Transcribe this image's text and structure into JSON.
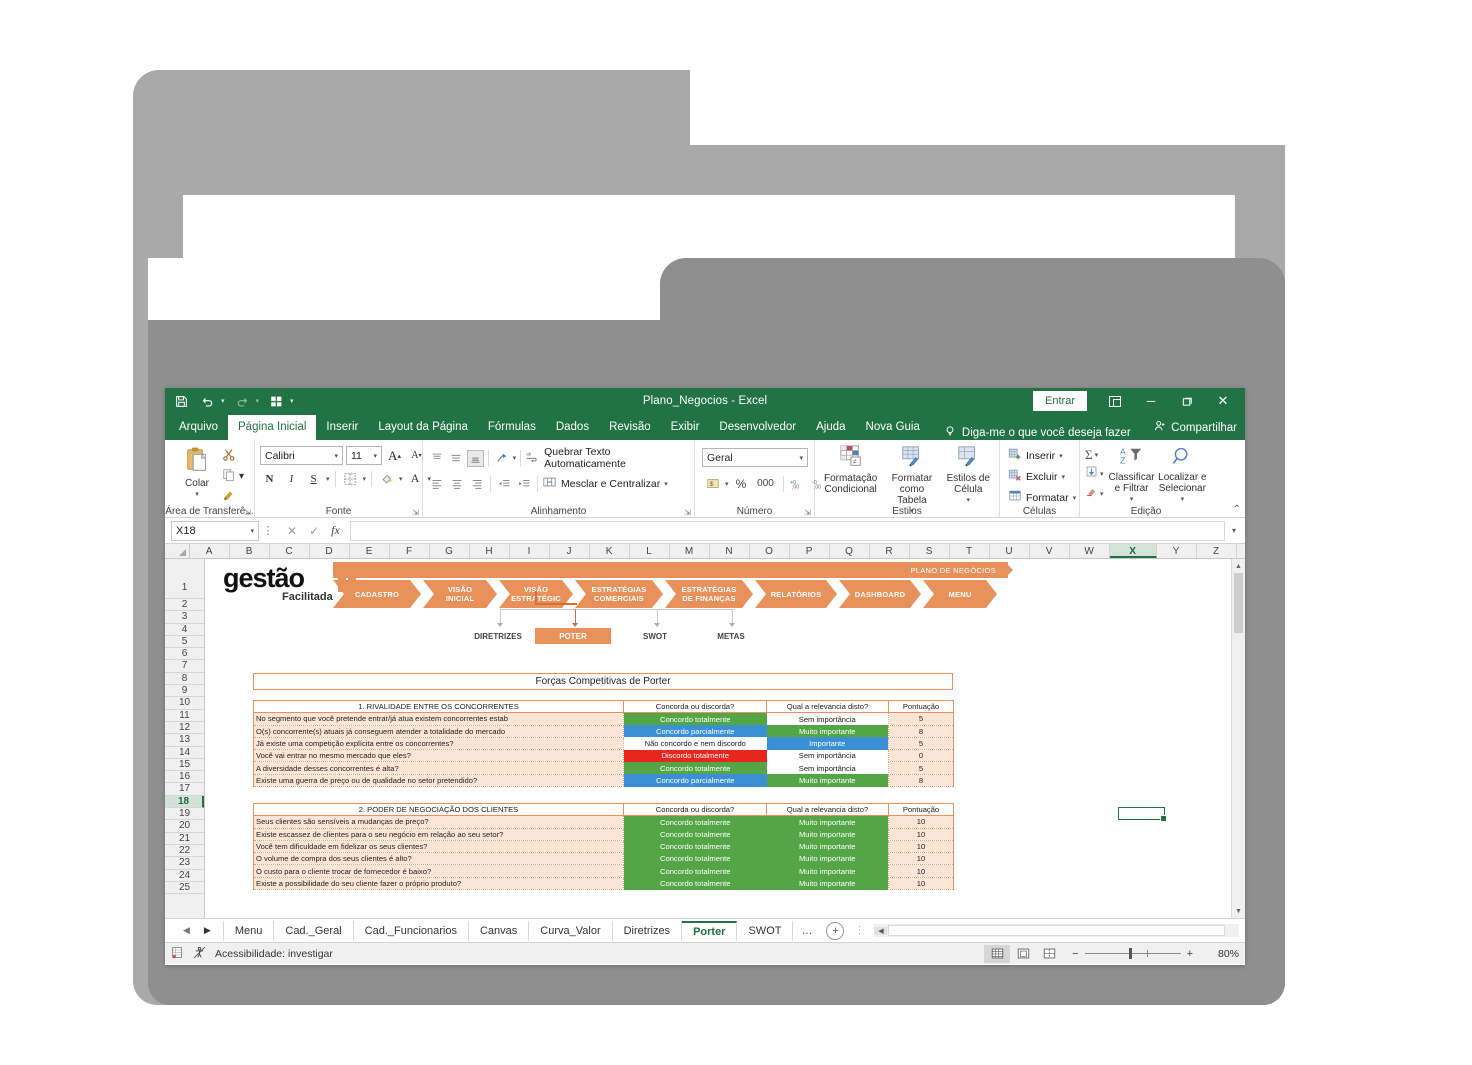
{
  "window": {
    "title": "Plano_Negocios  -  Excel",
    "signin_label": "Entrar",
    "ribbon_display_icon": "ribbon-display-options-icon",
    "minimize": "─",
    "restore": "❐",
    "close": "✕"
  },
  "qat": {
    "save": "save-icon",
    "undo": "undo-icon",
    "redo": "redo-icon",
    "quick_print": "quick-print-icon",
    "customize": "customize-qat-icon"
  },
  "ribbon_tabs": [
    {
      "label": "Arquivo",
      "active": false
    },
    {
      "label": "Página Inicial",
      "active": true
    },
    {
      "label": "Inserir",
      "active": false
    },
    {
      "label": "Layout da Página",
      "active": false
    },
    {
      "label": "Fórmulas",
      "active": false
    },
    {
      "label": "Dados",
      "active": false
    },
    {
      "label": "Revisão",
      "active": false
    },
    {
      "label": "Exibir",
      "active": false
    },
    {
      "label": "Desenvolvedor",
      "active": false
    },
    {
      "label": "Ajuda",
      "active": false
    },
    {
      "label": "Nova Guia",
      "active": false
    }
  ],
  "tell_me": "Diga-me o que você deseja fazer",
  "share_label": "Compartilhar",
  "ribbon": {
    "clipboard": {
      "group_label": "Área de Transferê...",
      "paste": "Colar",
      "cut": "Recortar",
      "copy": "Copiar",
      "format_painter": "Pincel de Formatação"
    },
    "font": {
      "group_label": "Fonte",
      "font_name": "Calibri",
      "font_size": "11",
      "grow": "A",
      "shrink": "A",
      "bold": "N",
      "italic": "I",
      "underline": "S",
      "borders": "borders-icon",
      "fill": "fill-color-icon",
      "color": "A"
    },
    "alignment": {
      "group_label": "Alinhamento",
      "wrap_text": "Quebrar Texto Automaticamente",
      "merge": "Mesclar e Centralizar"
    },
    "number": {
      "group_label": "Número",
      "format": "Geral",
      "accounting": "accounting-format-icon",
      "percent": "%",
      "comma": "000",
      "inc_dec": "increase-decimal-icon",
      "dec_dec": "decrease-decimal-icon"
    },
    "styles": {
      "group_label": "Estilos",
      "conditional": "Formatação\nCondicional",
      "conditional_l1": "Formatação",
      "conditional_l2": "Condicional",
      "as_table_l1": "Formatar como",
      "as_table_l2": "Tabela",
      "cell_styles_l1": "Estilos de",
      "cell_styles_l2": "Célula"
    },
    "cells": {
      "group_label": "Células",
      "insert": "Inserir",
      "delete": "Excluir",
      "format": "Formatar"
    },
    "editing": {
      "group_label": "Edição",
      "autosum": "Σ",
      "fill": "fill-down-icon",
      "clear": "clear-icon",
      "sort_l1": "Classificar",
      "sort_l2": "e Filtrar",
      "find_l1": "Localizar e",
      "find_l2": "Selecionar"
    }
  },
  "formula_bar": {
    "name_box": "X18",
    "cancel": "cancel-icon",
    "enter": "enter-icon",
    "fx": "fx",
    "value": ""
  },
  "grid": {
    "columns": [
      "A",
      "B",
      "C",
      "D",
      "E",
      "F",
      "G",
      "H",
      "I",
      "J",
      "K",
      "L",
      "M",
      "N",
      "O",
      "P",
      "Q",
      "R",
      "S",
      "T",
      "U",
      "V",
      "W",
      "X",
      "Y",
      "Z"
    ],
    "selected_column": "X",
    "rows": [
      1,
      2,
      3,
      4,
      5,
      6,
      7,
      8,
      9,
      10,
      11,
      12,
      13,
      14,
      15,
      16,
      17,
      18,
      19,
      20,
      21,
      22,
      23,
      24,
      25
    ],
    "selected_row": 18,
    "selected_cell": "X18"
  },
  "sheet": {
    "logo_main": "gestão",
    "logo_sub": "Facilitada",
    "banner_title": "PLANO DE NEGÓCIOS",
    "nav_chevrons": [
      {
        "l1": "CADASTRO",
        "l2": ""
      },
      {
        "l1": "VISÃO",
        "l2": "INICIAL"
      },
      {
        "l1": "VISÃO",
        "l2": "ESTRATÉGIC"
      },
      {
        "l1": "ESTRATÉGIAS",
        "l2": "COMERCIAIS"
      },
      {
        "l1": "ESTRATÉGIAS",
        "l2": "DE FINANÇAS"
      },
      {
        "l1": "RELATÓRIOS",
        "l2": ""
      },
      {
        "l1": "DASHBOARD",
        "l2": ""
      },
      {
        "l1": "MENU",
        "l2": ""
      }
    ],
    "sub_nav": [
      {
        "label": "DIRETRIZES",
        "active": false
      },
      {
        "label": "POTER",
        "active": true
      },
      {
        "label": "SWOT",
        "active": false
      },
      {
        "label": "METAS",
        "active": false
      }
    ],
    "page_title": "Forças Competitivas de Porter",
    "table_headers": {
      "col2": "Concorda ou discorda?",
      "col3": "Qual a relevancia disto?",
      "col4": "Pontuação"
    },
    "sections": [
      {
        "title": "1. RIVALIDADE ENTRE OS CONCORRENTES",
        "rows": [
          {
            "q": "No segmento que você pretende entrar/já atua existem concorrentes estab",
            "a": "Concordo totalmente",
            "a_color": "g",
            "rel": "Sem importância",
            "rel_color": "w",
            "score": "5"
          },
          {
            "q": "O(s) concorrente(s) atuais já conseguem atender a totalidade do mercado",
            "a": "Concordo parcialmente",
            "a_color": "b",
            "rel": "Muito importante",
            "rel_color": "g",
            "score": "8"
          },
          {
            "q": "Já existe uma competição explícita entre os concorrentes?",
            "a": "Não concordo e nem discordo",
            "a_color": "w",
            "rel": "Importante",
            "rel_color": "b",
            "score": "5"
          },
          {
            "q": "Você vai entrar no mesmo mercado que eles?",
            "a": "Discordo totalmente",
            "a_color": "r",
            "rel": "Sem importância",
            "rel_color": "w",
            "score": "0"
          },
          {
            "q": "A diversidade desses concorrentes é alta?",
            "a": "Concordo totalmente",
            "a_color": "g",
            "rel": "Sem importância",
            "rel_color": "w",
            "score": "5"
          },
          {
            "q": "Existe uma guerra de preço ou de qualidade no setor pretendido?",
            "a": "Concordo parcialmente",
            "a_color": "b",
            "rel": "Muito importante",
            "rel_color": "g",
            "score": "8"
          }
        ]
      },
      {
        "title": "2. PODER DE NEGOCIAÇÃO DOS CLIENTES",
        "rows": [
          {
            "q": "Seus clientes são sensíveis a mudanças de preço?",
            "a": "Concordo totalmente",
            "a_color": "g",
            "rel": "Muito importante",
            "rel_color": "g",
            "score": "10"
          },
          {
            "q": "Existe escassez de clientes para o seu negócio em relação ao seu setor?",
            "a": "Concordo totalmente",
            "a_color": "g",
            "rel": "Muito importante",
            "rel_color": "g",
            "score": "10"
          },
          {
            "q": "Você tem dificuldade em fidelizar os seus clientes?",
            "a": "Concordo totalmente",
            "a_color": "g",
            "rel": "Muito importante",
            "rel_color": "g",
            "score": "10"
          },
          {
            "q": "O volume de compra dos seus clientes é alto?",
            "a": "Concordo totalmente",
            "a_color": "g",
            "rel": "Muito importante",
            "rel_color": "g",
            "score": "10"
          },
          {
            "q": "O custo para o cliente trocar de fornecedor é baixo?",
            "a": "Concordo totalmente",
            "a_color": "g",
            "rel": "Muito importante",
            "rel_color": "g",
            "score": "10"
          },
          {
            "q": "Existe a possibilidade do seu cliente fazer o próprio produto?",
            "a": "Concordo totalmente",
            "a_color": "g",
            "rel": "Muito importante",
            "rel_color": "g",
            "score": "10"
          }
        ]
      }
    ]
  },
  "sheet_tabs": {
    "prev": "◀",
    "next": "▶",
    "items": [
      {
        "label": "Menu",
        "active": false
      },
      {
        "label": "Cad._Geral",
        "active": false
      },
      {
        "label": "Cad._Funcionarios",
        "active": false
      },
      {
        "label": "Canvas",
        "active": false
      },
      {
        "label": "Curva_Valor",
        "active": false
      },
      {
        "label": "Diretrizes",
        "active": false
      },
      {
        "label": "Porter",
        "active": true
      },
      {
        "label": "SWOT",
        "active": false
      }
    ],
    "more": "…",
    "add": "+"
  },
  "status_bar": {
    "accessibility": "Acessibilidade: investigar",
    "views": [
      "normal-view-icon",
      "page-layout-icon",
      "page-break-icon"
    ],
    "zoom": "80%",
    "zoom_out": "−",
    "zoom_in": "+"
  },
  "colors": {
    "excel_green": "#217346",
    "accent_orange": "#e8915b",
    "green_cell": "#54a546",
    "blue_cell": "#3b8fd4",
    "red_cell": "#e8261e",
    "peach_cell": "#fbe5d6",
    "folder_back": "#a9a9a9",
    "folder_front": "#8f8f8f"
  }
}
